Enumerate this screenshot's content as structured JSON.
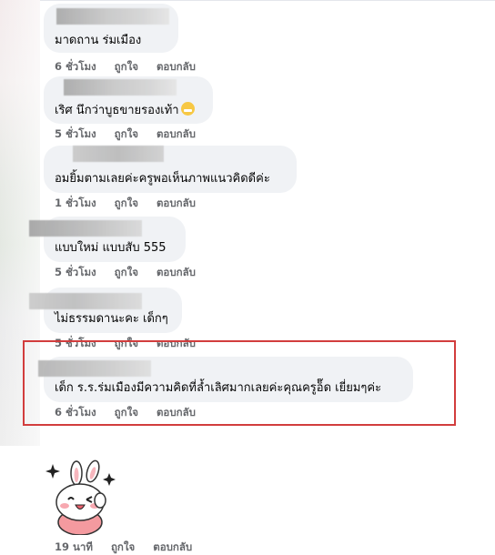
{
  "actions": {
    "like": "ถูกใจ",
    "reply": "ตอบกลับ"
  },
  "comments": [
    {
      "text": "มาดถาน ร่มเมือง",
      "time": "6 ชั่วโมง"
    },
    {
      "text": "เริศ นึกว่าบูธขายรองเท้า",
      "emoji": "grinning-face-icon",
      "time": "5 ชั่วโมง"
    },
    {
      "text": "อมยิ้มตามเลยค่ะครูพอเห็นภาพแนวคิดดีค่ะ",
      "time": "1 ชั่วโมง"
    },
    {
      "text": "แบบใหม่ แบบสับ 555",
      "time": "5 ชั่วโมง"
    },
    {
      "text": "ไม่ธรรมดานะคะ เด็กๆ",
      "time": "5 ชั่วโมง"
    },
    {
      "text": "เด็ก ร.ร.ร่มเมืองมีความคิดที่ล้ำเลิศมากเลยค่ะคุณครูอ็๊ด เยี่ยมๆค่ะ",
      "time": "6 ชั่วโมง"
    },
    {
      "sticker": "bunny-sticker-icon",
      "time": "19 นาที"
    }
  ],
  "colors": {
    "bubble": "#f0f2f5",
    "meta": "#65676b",
    "highlight": "#d23d3d"
  }
}
